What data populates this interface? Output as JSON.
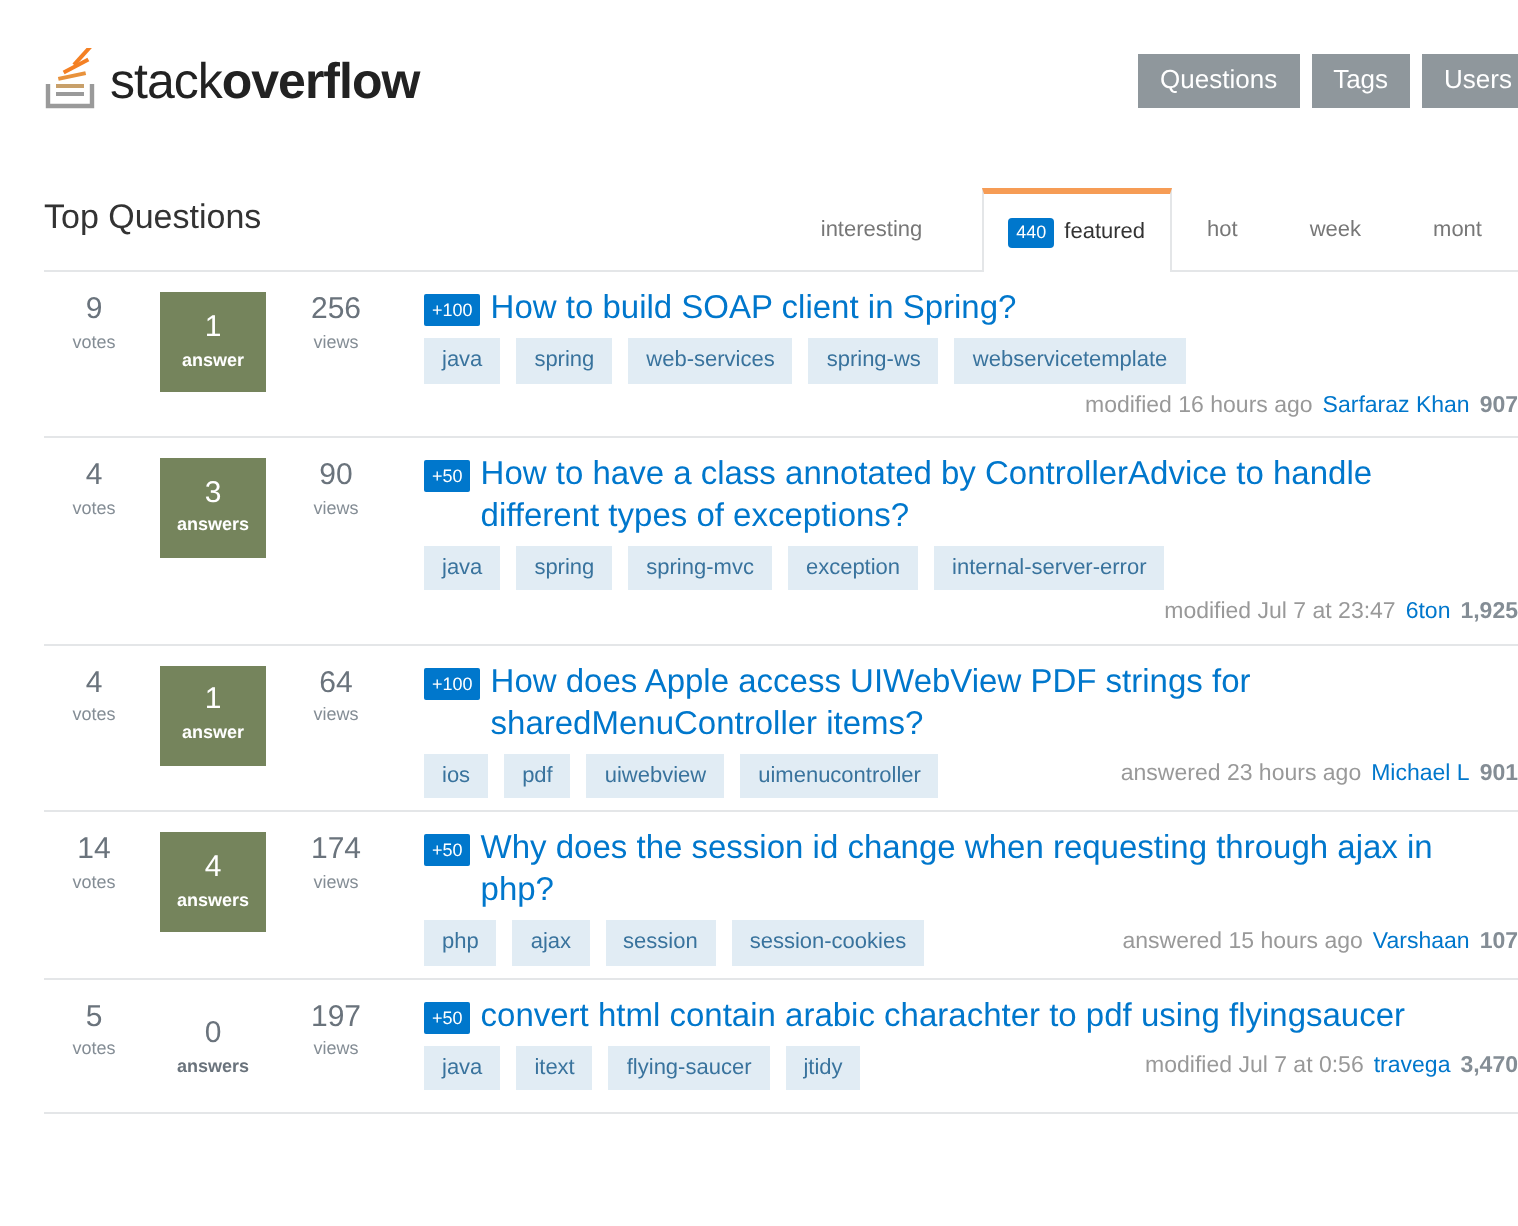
{
  "logo": {
    "text": "stack**overflow**"
  },
  "nav": [
    "Questions",
    "Tags",
    "Users"
  ],
  "heading": "Top Questions",
  "tabs": [
    {
      "label": "interesting",
      "selected": false
    },
    {
      "label": "featured",
      "badge": "440",
      "selected": true
    },
    {
      "label": "hot",
      "selected": false
    },
    {
      "label": "week",
      "selected": false
    },
    {
      "label": "mont",
      "selected": false
    }
  ],
  "questions": [
    {
      "votes": "9",
      "votes_label": "votes",
      "answers": "1",
      "answers_label": "answer",
      "answered": true,
      "views": "256",
      "views_label": "views",
      "bounty": "+100",
      "title": "How to build SOAP client in Spring?",
      "tags": [
        "java",
        "spring",
        "web-services",
        "spring-ws",
        "webservicetemplate"
      ],
      "action": "modified 16 hours ago",
      "user": "Sarfaraz Khan",
      "rep": "907"
    },
    {
      "votes": "4",
      "votes_label": "votes",
      "answers": "3",
      "answers_label": "answers",
      "answered": true,
      "views": "90",
      "views_label": "views",
      "bounty": "+50",
      "title": "How to have a class annotated by ControllerAdvice to handle different types of exceptions?",
      "tags": [
        "java",
        "spring",
        "spring-mvc",
        "exception",
        "internal-server-error"
      ],
      "action": "modified Jul 7 at 23:47",
      "user": "6ton",
      "rep": "1,925"
    },
    {
      "votes": "4",
      "votes_label": "votes",
      "answers": "1",
      "answers_label": "answer",
      "answered": true,
      "views": "64",
      "views_label": "views",
      "bounty": "+100",
      "title": "How does Apple access UIWebView PDF strings for sharedMenuController items?",
      "tags": [
        "ios",
        "pdf",
        "uiwebview",
        "uimenucontroller"
      ],
      "action": "answered 23 hours ago",
      "user": "Michael L",
      "rep": "901"
    },
    {
      "votes": "14",
      "votes_label": "votes",
      "answers": "4",
      "answers_label": "answers",
      "answered": true,
      "views": "174",
      "views_label": "views",
      "bounty": "+50",
      "title": "Why does the session id change when requesting through ajax in php?",
      "tags": [
        "php",
        "ajax",
        "session",
        "session-cookies"
      ],
      "action": "answered 15 hours ago",
      "user": "Varshaan",
      "rep": "107"
    },
    {
      "votes": "5",
      "votes_label": "votes",
      "answers": "0",
      "answers_label": "answers",
      "answered": false,
      "views": "197",
      "views_label": "views",
      "bounty": "+50",
      "title": "convert html contain arabic charachter to pdf using flyingsaucer",
      "tags": [
        "java",
        "itext",
        "flying-saucer",
        "jtidy"
      ],
      "action": "modified Jul 7 at 0:56",
      "user": "travega",
      "rep": "3,470"
    }
  ]
}
